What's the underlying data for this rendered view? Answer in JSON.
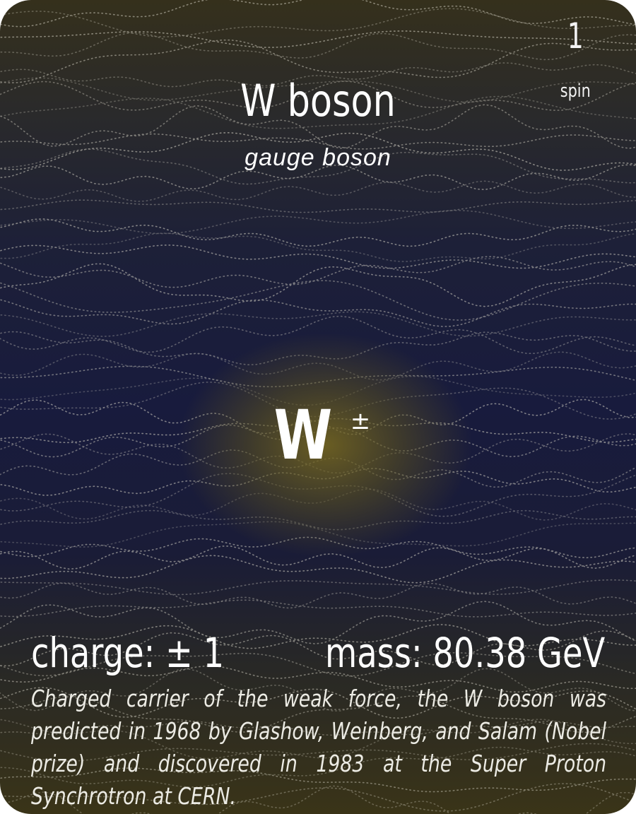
{
  "card": {
    "name": "W boson",
    "category": "gauge boson",
    "spin_value": "1",
    "spin_label": "spin",
    "symbol": "W",
    "symbol_superscript": "±",
    "charge_text": "charge: ± 1",
    "mass_text": "mass: 80.38 GeV",
    "description": "Charged carrier of the weak force, the W boson was predicted in 1968 by Glashow, Weinberg, and Salam (Nobel prize) and discovered in 1983 at the Super Proton Synchrotron at CERN."
  },
  "colors": {
    "background_top": "#35301c",
    "background_middle": "#181b3d",
    "background_bottom": "#3a3418",
    "glow": "#786920",
    "text": "#ffffff"
  }
}
